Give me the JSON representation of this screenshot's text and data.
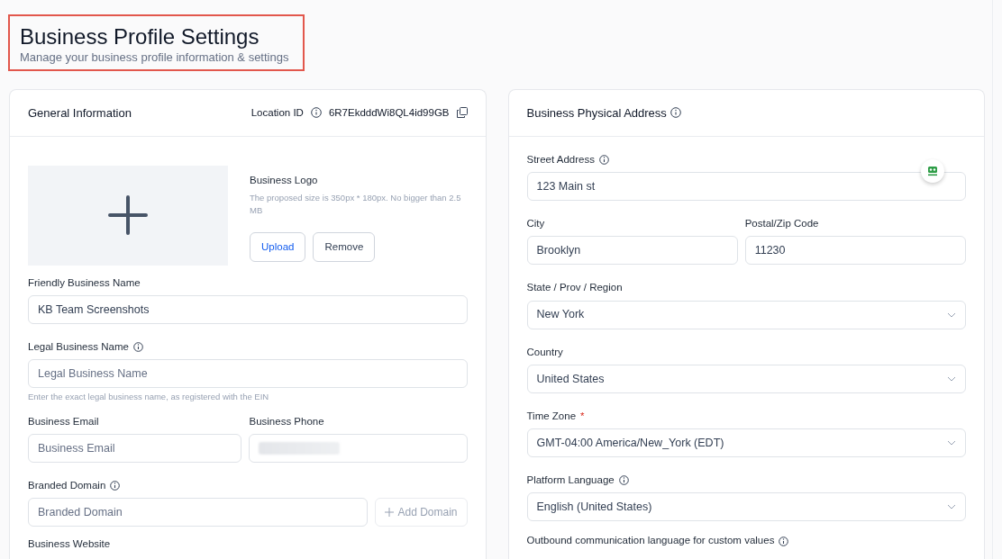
{
  "header": {
    "title": "Business Profile Settings",
    "subtitle": "Manage your business profile information & settings",
    "highlighted": true
  },
  "general": {
    "title": "General Information",
    "location_label": "Location ID",
    "location_id": "6R7EkdddWi8QL4id99GB",
    "logo": {
      "label": "Business Logo",
      "hint": "The proposed size is 350px * 180px. No bigger than 2.5 MB",
      "buttons": [
        {
          "label": "Upload",
          "kind": "primary"
        },
        {
          "label": "Remove",
          "kind": "secondary"
        }
      ]
    },
    "rows": [
      [
        {
          "kind": "text",
          "label": "Friendly Business Name",
          "info": false,
          "value": "KB Team Screenshots"
        }
      ],
      [
        {
          "kind": "text",
          "label": "Legal Business Name",
          "info": true,
          "placeholder": "Legal Business Name",
          "hint": "Enter the exact legal business name, as registered with the EIN"
        }
      ],
      [
        {
          "kind": "text",
          "label": "Business Email",
          "info": false,
          "placeholder": "Business Email"
        },
        {
          "kind": "text",
          "label": "Business Phone",
          "info": false,
          "redacted": true
        }
      ],
      [
        {
          "kind": "text_with_button",
          "label": "Branded Domain",
          "info": true,
          "placeholder": "Branded Domain",
          "button": "Add Domain"
        }
      ],
      [
        {
          "kind": "label_only",
          "label": "Business Website",
          "info": false
        }
      ]
    ]
  },
  "address": {
    "title": "Business Physical Address",
    "info": true,
    "rows": [
      [
        {
          "kind": "text",
          "label": "Street Address",
          "info": true,
          "value": "123 Main st"
        }
      ],
      [
        {
          "kind": "text",
          "label": "City",
          "info": false,
          "value": "Brooklyn"
        },
        {
          "kind": "text",
          "label": "Postal/Zip Code",
          "info": false,
          "value": "11230"
        }
      ],
      [
        {
          "kind": "select",
          "label": "State / Prov / Region",
          "info": false,
          "value": "New York"
        }
      ],
      [
        {
          "kind": "select",
          "label": "Country",
          "info": false,
          "value": "United States"
        }
      ],
      [
        {
          "kind": "select",
          "label": "Time Zone",
          "info": false,
          "required": true,
          "required_mark": "*",
          "value": "GMT-04:00 America/New_York (EDT)"
        }
      ],
      [
        {
          "kind": "select",
          "label": "Platform Language",
          "info": true,
          "value": "English (United States)"
        }
      ],
      [
        {
          "kind": "label_only",
          "label": "Outbound communication language for custom values",
          "info": true
        }
      ]
    ]
  }
}
